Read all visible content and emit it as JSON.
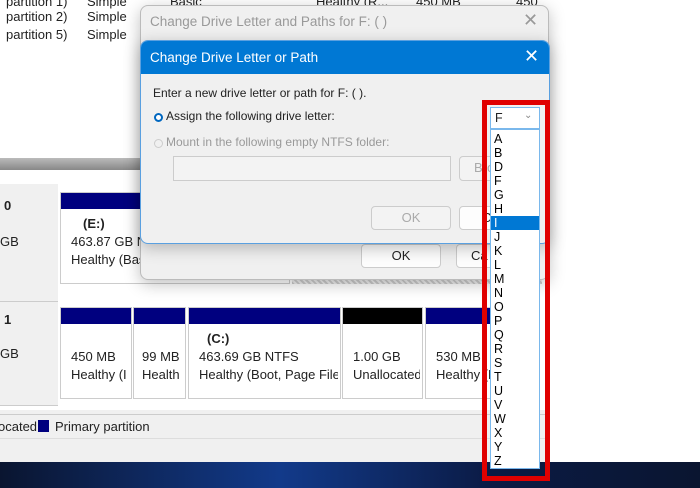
{
  "volume_list": [
    {
      "name": "partition 1)",
      "layout": "Simple",
      "type": "Basic",
      "status": "Healthy (R...",
      "capacity": "450 MB",
      "free": "450"
    },
    {
      "name": "partition 2)",
      "layout": "Simple"
    },
    {
      "name": "partition 5)",
      "layout": "Simple"
    }
  ],
  "disks": [
    {
      "label": "0",
      "size": "GB",
      "partitions": [
        {
          "letter": "(E:)",
          "size": "463.87 GB N",
          "status": "Healthy (Bas"
        }
      ]
    },
    {
      "label": "1",
      "size": "GB",
      "partitions": [
        {
          "size": "450 MB",
          "status": "Healthy (I"
        },
        {
          "size": "99 MB",
          "status": "Health"
        },
        {
          "letter": "(C:)",
          "size": "463.69 GB NTFS",
          "status": "Healthy (Boot, Page File"
        },
        {
          "size": "1.00 GB",
          "status": "Unallocated"
        },
        {
          "size": "530 MB",
          "status": "Healthy (R"
        }
      ]
    }
  ],
  "legend": {
    "unallocated": "ocated",
    "primary": "Primary partition"
  },
  "back_dialog": {
    "title": "Change Drive Letter and Paths for F: ( )",
    "ok": "OK",
    "cancel": "Ca"
  },
  "dialog": {
    "title": "Change Drive Letter or Path",
    "prompt": "Enter a new drive letter or path for F: ( ).",
    "assign_label": "Assign the following drive letter:",
    "mount_label": "Mount in the following empty NTFS folder:",
    "browse": "Bro",
    "ok": "OK",
    "cancel": "C",
    "selected_letter": "F",
    "highlighted_letter": "I",
    "letters": [
      "A",
      "B",
      "D",
      "F",
      "G",
      "H",
      "I",
      "J",
      "K",
      "L",
      "M",
      "N",
      "O",
      "P",
      "Q",
      "R",
      "S",
      "T",
      "U",
      "V",
      "W",
      "X",
      "Y",
      "Z"
    ]
  },
  "colors": {
    "accent": "#0078d4",
    "primary_partition": "#00007f",
    "highlight": "#e00000"
  }
}
